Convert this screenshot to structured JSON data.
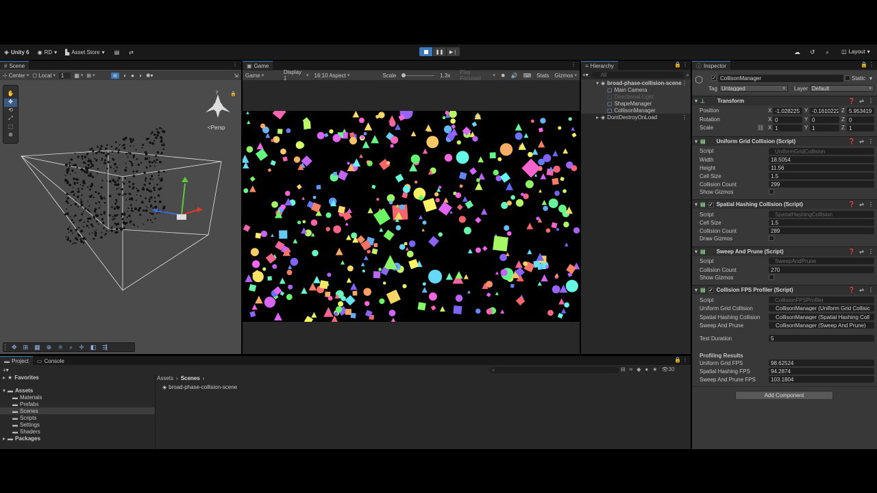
{
  "toolbar": {
    "unity": "Unity 6",
    "account": "RD",
    "asset_store": "Asset Store",
    "layout": "Layout"
  },
  "scene": {
    "tab": "Scene",
    "pivot": "Center",
    "space": "Local",
    "snap_value": "1",
    "persp": "<Persp"
  },
  "game": {
    "tab": "Game",
    "mode": "Game",
    "display": "Display 1",
    "aspect": "16:10 Aspect",
    "scale_label": "Scale",
    "scale_value": "1.3x",
    "play_focused": "Play Focused",
    "stats": "Stats",
    "gizmos": "Gizmos"
  },
  "hierarchy": {
    "tab": "Hierarchy",
    "search_placeholder": "All",
    "scene_name": "broad-phase-collision-scene",
    "items": [
      "Main Camera",
      "Directional Light",
      "ShapeManager",
      "CollisonManager"
    ],
    "ddol": "DontDestroyOnLoad"
  },
  "inspector": {
    "tab": "Inspector",
    "object_name": "CollisonManager",
    "static": "Static",
    "tag_label": "Tag",
    "tag_value": "Untagged",
    "layer_label": "Layer",
    "layer_value": "Default",
    "transform": {
      "title": "Transform",
      "position_label": "Position",
      "rotation_label": "Rotation",
      "scale_label": "Scale",
      "position": [
        "-1.028225",
        "-0.1610222",
        "5.953419"
      ],
      "rotation": [
        "0",
        "0",
        "0"
      ],
      "scale": [
        "1",
        "1",
        "1"
      ],
      "axes": [
        "X",
        "Y",
        "Z"
      ]
    },
    "uniform": {
      "title": "Uniform Grid Collision (Script)",
      "script_label": "Script",
      "script": "UniformGridCollision",
      "width_label": "Width",
      "width": "18.5054",
      "height_label": "Height",
      "height": "11.56",
      "cell_label": "Cell Size",
      "cell": "1.5",
      "count_label": "Collision Count",
      "count": "299",
      "gizmos_label": "Show Gizmos"
    },
    "spatial": {
      "title": "Spatial Hashing Collision (Script)",
      "script_label": "Script",
      "script": "SpatialHashingCollision",
      "cell_label": "Cell Size",
      "cell": "1.5",
      "count_label": "Collision Count",
      "count": "289",
      "gizmos_label": "Draw Gizmos"
    },
    "sweep": {
      "title": "Sweep And Prune (Script)",
      "script_label": "Script",
      "script": "SweepAndPrune",
      "count_label": "Collision Count",
      "count": "270",
      "gizmos_label": "Show Gizmos"
    },
    "profiler": {
      "title": "Collision FPS Profiler (Script)",
      "script_label": "Script",
      "script": "CollisionFPSProfiler",
      "ugc_label": "Uniform Grid Collision",
      "ugc": "CollisonManager (Uniform Grid Collisic",
      "shc_label": "Spatial Hashing Collision",
      "shc": "CollisonManager (Spatial Hashing Coll",
      "sap_label": "Sweep And Prune",
      "sap": "CollisonManager (Sweep And Prune)",
      "duration_label": "Test Duration",
      "duration": "5",
      "results_title": "Profiling Results",
      "ugc_fps_label": "Uniform Grid FPS",
      "ugc_fps": "98.62524",
      "shc_fps_label": "Spatial Hashing FPS",
      "shc_fps": "94.2874",
      "sap_fps_label": "Sweep And Prune FPS",
      "sap_fps": "103.1804"
    },
    "add_component": "Add Component"
  },
  "project": {
    "tab_project": "Project",
    "tab_console": "Console",
    "favorites": "Favorites",
    "assets": "Assets",
    "folders": [
      "Materials",
      "Prefabs",
      "Scenes",
      "Scripts",
      "Settings",
      "Shaders"
    ],
    "packages": "Packages",
    "breadcrumb": [
      "Assets",
      "Scenes"
    ],
    "file": "broad-phase-collision-scene",
    "count": "30"
  },
  "colors": {
    "accent": "#3a79bb",
    "panel": "#282828",
    "toolbar": "#191919"
  }
}
